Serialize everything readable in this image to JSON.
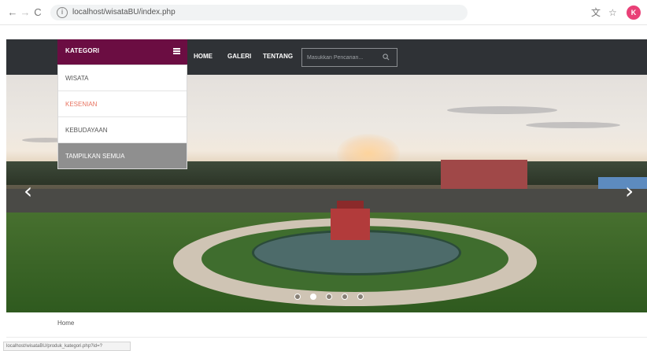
{
  "browser": {
    "url": "localhost/wisataBU/index.php",
    "avatar_initial": "K",
    "icons": [
      "back-icon",
      "forward-icon",
      "reload-icon",
      "info-icon",
      "translate-icon",
      "star-icon"
    ]
  },
  "nav": {
    "category_label": "KATEGORI",
    "links": [
      "HOME",
      "GALERI",
      "TENTANG"
    ],
    "search_placeholder": "Masukkan Pencarian..."
  },
  "dropdown": {
    "items": [
      "WISATA",
      "KESENIAN",
      "KEBUDAYAAN",
      "TAMPILKAN SEMUA"
    ],
    "active_item": "KESENIAN"
  },
  "slider": {
    "slide_count": 5,
    "active_index": 1
  },
  "breadcrumb": "Home",
  "status_bar": "localhost/wisataBU/produk_kategori.php?id=?",
  "colors": {
    "nav_bg": "#2f3236",
    "category_bg": "#6b0d42",
    "active_item": "#e87360",
    "show_all_bg": "#8f8f8f",
    "avatar": "#e94077"
  }
}
